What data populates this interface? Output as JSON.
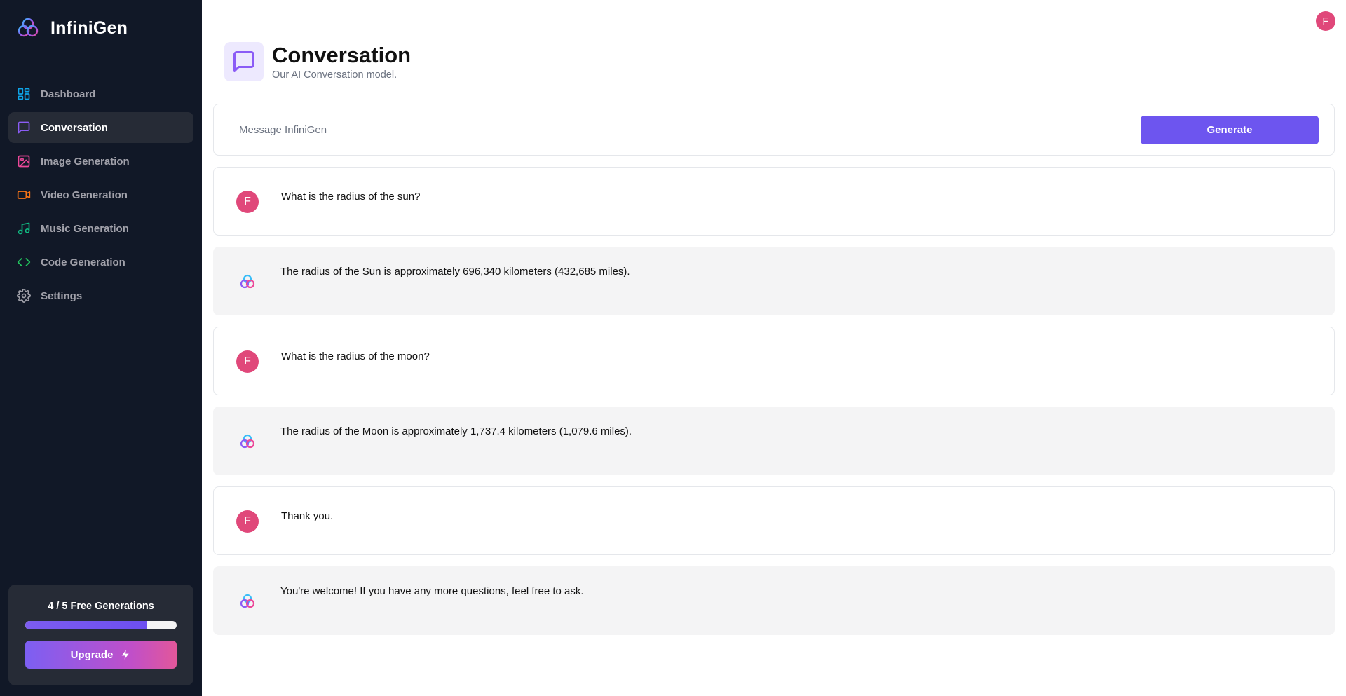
{
  "app": {
    "name": "InfiniGen",
    "user_initial": "F"
  },
  "sidebar": {
    "items": [
      {
        "label": "Dashboard",
        "icon": "dashboard-icon",
        "color": "#0ea5e9"
      },
      {
        "label": "Conversation",
        "icon": "chat-icon",
        "color": "#8b5cf6"
      },
      {
        "label": "Image Generation",
        "icon": "image-icon",
        "color": "#ec4899"
      },
      {
        "label": "Video Generation",
        "icon": "video-icon",
        "color": "#f97316"
      },
      {
        "label": "Music Generation",
        "icon": "music-icon",
        "color": "#10b981"
      },
      {
        "label": "Code Generation",
        "icon": "code-icon",
        "color": "#22c55e"
      },
      {
        "label": "Settings",
        "icon": "gear-icon",
        "color": "#a1a1aa"
      }
    ],
    "active": "Conversation"
  },
  "quota": {
    "text": "4 / 5 Free Generations",
    "used": 4,
    "total": 5,
    "progress_fraction": 0.8,
    "upgrade_label": "Upgrade"
  },
  "header": {
    "title": "Conversation",
    "subtitle": "Our AI Conversation model."
  },
  "composer": {
    "placeholder": "Message InfiniGen",
    "value": "",
    "generate_label": "Generate"
  },
  "messages": [
    {
      "role": "user",
      "avatar": "F",
      "text": "What is the radius of the sun?"
    },
    {
      "role": "bot",
      "text": "The radius of the Sun is approximately 696,340 kilometers (432,685 miles)."
    },
    {
      "role": "user",
      "avatar": "F",
      "text": "What is the radius of the moon?"
    },
    {
      "role": "bot",
      "text": "The radius of the Moon is approximately 1,737.4 kilometers (1,079.6 miles)."
    },
    {
      "role": "user",
      "avatar": "F",
      "text": "Thank you."
    },
    {
      "role": "bot",
      "text": "You're welcome! If you have any more questions, feel free to ask."
    }
  ],
  "colors": {
    "sidebar_bg": "#111827",
    "accent": "#6d55ef",
    "avatar": "#e0487a"
  }
}
